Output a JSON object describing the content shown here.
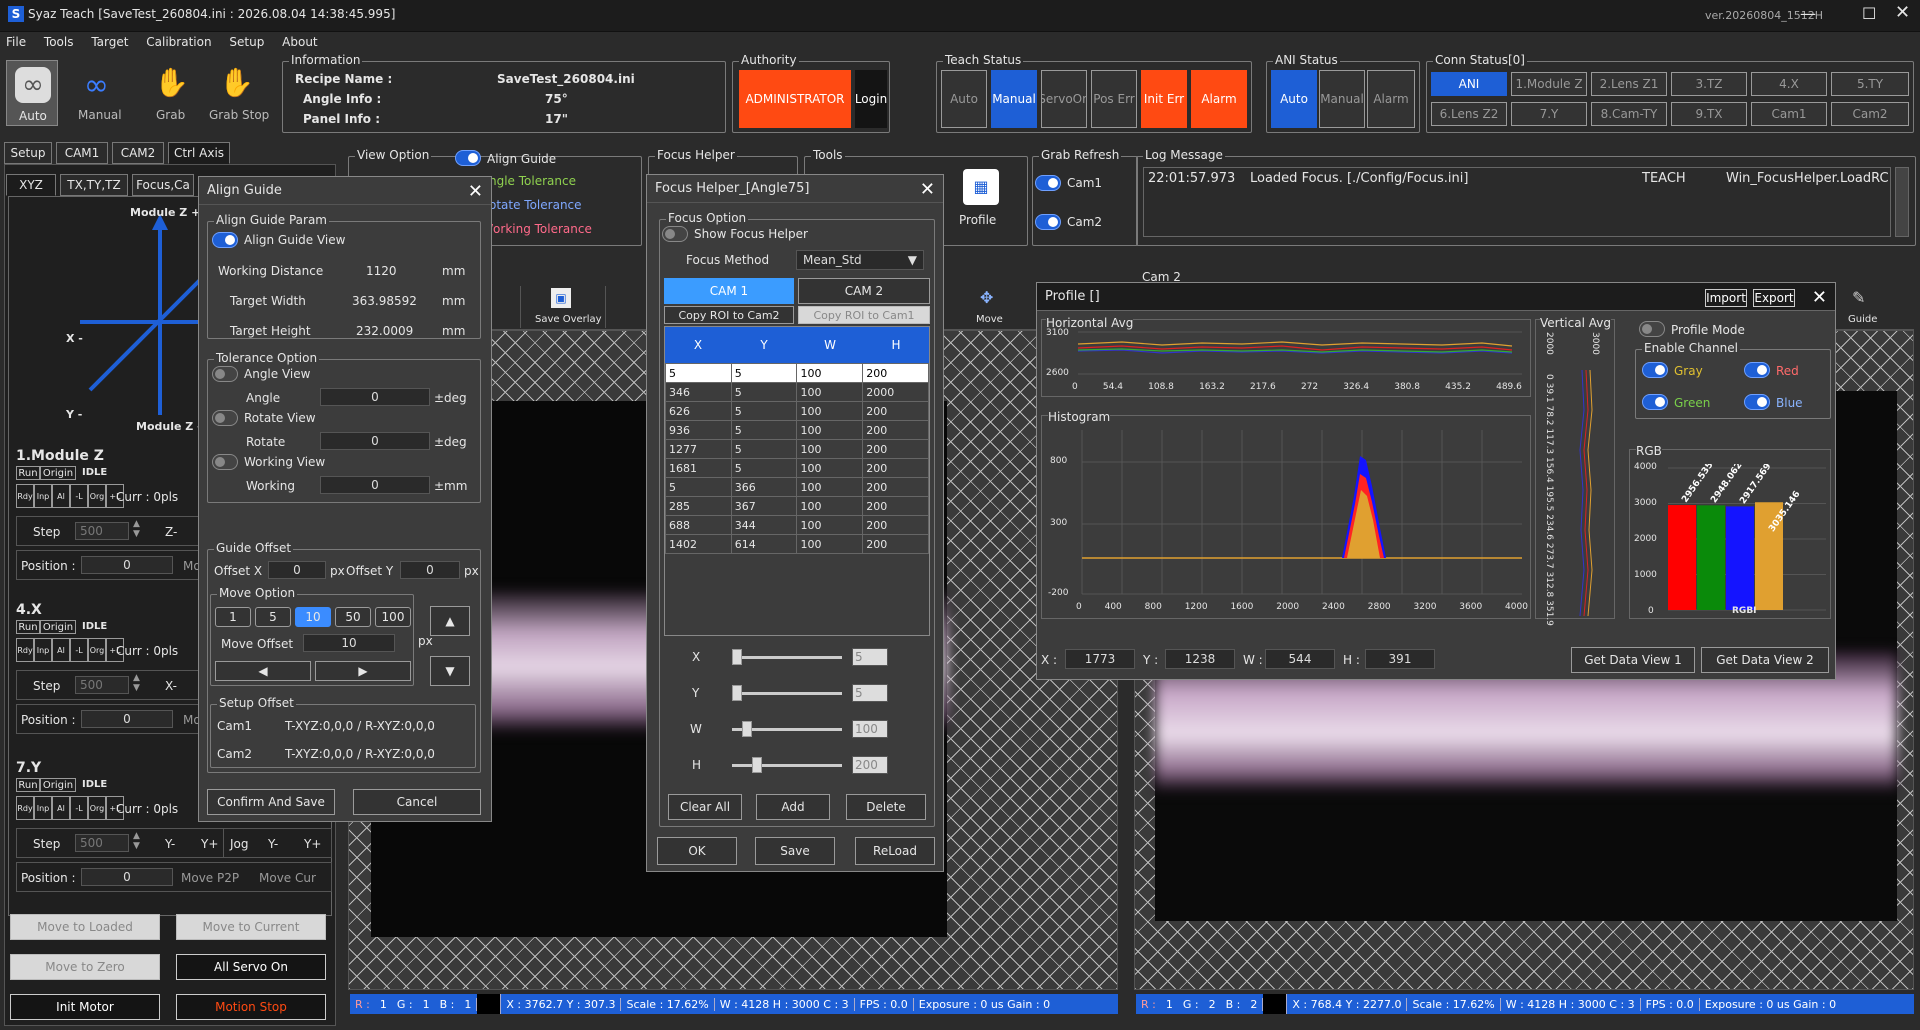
{
  "window": {
    "title": "Syaz Teach [SaveTest_260804.ini : 2026.08.04 14:38:45.995]",
    "version": "ver.20260804_1512H"
  },
  "menu": [
    "File",
    "Tools",
    "Target",
    "Calibration",
    "Setup",
    "About"
  ],
  "toolbar": {
    "auto": "Auto",
    "manual": "Manual",
    "grab": "Grab",
    "grab_stop": "Grab Stop"
  },
  "info": {
    "title": "Information",
    "recipe_label": "Recipe Name :",
    "recipe": "SaveTest_260804.ini",
    "angle_label": "Angle Info :",
    "angle": "75°",
    "panel_label": "Panel Info :",
    "panel": "17\""
  },
  "authority": {
    "title": "Authority",
    "role": "ADMINISTRATOR",
    "login": "Login"
  },
  "teach_status": {
    "title": "Teach Status",
    "items": [
      "Auto",
      "Manual",
      "ServoOn",
      "Pos Err",
      "Init Err",
      "Alarm"
    ]
  },
  "ani_status": {
    "title": "ANI Status",
    "items": [
      "Auto",
      "Manual",
      "Alarm"
    ]
  },
  "conn_status": {
    "title": "Conn Status[0]",
    "row1": [
      "ANI",
      "1.Module Z",
      "2.Lens Z1",
      "3.TZ",
      "4.X",
      "5.TY"
    ],
    "row2": [
      "6.Lens Z2",
      "7.Y",
      "8.Cam-TY",
      "9.TX",
      "Cam1",
      "Cam2"
    ]
  },
  "left_tabs": [
    "Setup",
    "CAM1",
    "CAM2",
    "Ctrl Axis"
  ],
  "sub_tabs": [
    "XYZ",
    "TX,TY,TZ",
    "Focus,Ca"
  ],
  "axis_diagram": {
    "top": "Module Z +",
    "x": "X -",
    "y": "Y -",
    "bottom": "Module Z -"
  },
  "axes": [
    {
      "name": "1.Module Z",
      "run": "Run",
      "origin": "Origin",
      "state": "IDLE",
      "flags": [
        "Rdy",
        "Inp",
        "Al",
        "-L",
        "Org",
        "+L"
      ],
      "curr": "Curr : 0pls",
      "step_label": "Step",
      "step": "500",
      "minus": "Z-",
      "pos_label": "Position :",
      "pos": "0",
      "move": "Mo"
    },
    {
      "name": "4.X",
      "run": "Run",
      "origin": "Origin",
      "state": "IDLE",
      "flags": [
        "Rdy",
        "Inp",
        "Al",
        "-L",
        "Org",
        "+L"
      ],
      "curr": "Curr : 0pls",
      "step_label": "Step",
      "step": "500",
      "minus": "X-",
      "pos_label": "Position :",
      "pos": "0",
      "move": "Mo"
    },
    {
      "name": "7.Y",
      "run": "Run",
      "origin": "Origin",
      "state": "IDLE",
      "flags": [
        "Rdy",
        "Inp",
        "Al",
        "-L",
        "Org",
        "+L"
      ],
      "curr": "Curr : 0pls",
      "step_label": "Step",
      "step": "500",
      "minus": "Y-",
      "plus": "Y+",
      "jog": "Jog",
      "jog_minus": "Y-",
      "jog_plus": "Y+",
      "pos_label": "Position :",
      "pos": "0",
      "move_p2p": "Move P2P",
      "move_cur": "Move Cur"
    }
  ],
  "bottom_buttons": {
    "move_loaded": "Move to Loaded",
    "move_current": "Move to Current",
    "move_zero": "Move to Zero",
    "all_servo": "All Servo On",
    "init_motor": "Init Motor",
    "motion_stop": "Motion Stop"
  },
  "view_option": {
    "title": "View Option",
    "align_guide": "Align Guide",
    "angle_tol": "ngle Tolerance",
    "rotate_tol": "otate Tolerance",
    "working_tol": "/orking Tolerance"
  },
  "align_dialog": {
    "title": "Align Guide",
    "param_title": "Align Guide Param",
    "view": "Align Guide View",
    "wd_label": "Working Distance",
    "wd": "1120",
    "tw_label": "Target Width",
    "tw": "363.98592",
    "th_label": "Target Height",
    "th": "232.0009",
    "unit_mm": "mm",
    "tol_title": "Tolerance Option",
    "angle_view": "Angle View",
    "angle": "Angle",
    "angle_val": "0",
    "deg": "±deg",
    "rotate_view": "Rotate View",
    "rotate": "Rotate",
    "rotate_val": "0",
    "working_view": "Working View",
    "working": "Working",
    "working_val": "0",
    "pmm": "±mm",
    "guide_title": "Guide Offset",
    "offx_label": "Offset X",
    "offx": "0",
    "px": "px",
    "offy_label": "Offset Y",
    "offy": "0",
    "move_title": "Move Option",
    "move_opts": [
      "1",
      "5",
      "10",
      "50",
      "100"
    ],
    "move_offset_label": "Move Offset",
    "move_offset": "10",
    "setup_title": "Setup Offset",
    "cam1_label": "Cam1",
    "cam1": "T-XYZ:0,0,0 / R-XYZ:0,0,0",
    "cam2_label": "Cam2",
    "cam2": "T-XYZ:0,0,0 / R-XYZ:0,0,0",
    "confirm": "Confirm And Save",
    "cancel": "Cancel"
  },
  "focus_group_title": "Focus Helper",
  "tools": {
    "title": "Tools",
    "profile": "Profile",
    "save_overlay": "Save Overlay",
    "move": "Move",
    "guide": "Guide"
  },
  "focus_dialog": {
    "title": "Focus Helper_[Angle75]",
    "option_title": "Focus Option",
    "show": "Show Focus Helper",
    "method_label": "Focus Method",
    "method": "Mean_Std",
    "cam1": "CAM 1",
    "cam2": "CAM 2",
    "copy_to_cam2": "Copy ROI to Cam2",
    "copy_to_cam1": "Copy ROI to Cam1",
    "headers": [
      "X",
      "Y",
      "W",
      "H"
    ],
    "rows": [
      [
        "5",
        "5",
        "100",
        "200"
      ],
      [
        "346",
        "5",
        "100",
        "2000"
      ],
      [
        "626",
        "5",
        "100",
        "200"
      ],
      [
        "936",
        "5",
        "100",
        "200"
      ],
      [
        "1277",
        "5",
        "100",
        "200"
      ],
      [
        "1681",
        "5",
        "100",
        "200"
      ],
      [
        "5",
        "366",
        "100",
        "200"
      ],
      [
        "285",
        "367",
        "100",
        "200"
      ],
      [
        "688",
        "344",
        "100",
        "200"
      ],
      [
        "1402",
        "614",
        "100",
        "200"
      ]
    ],
    "sx_label": "X",
    "sx": "5",
    "sy_label": "Y",
    "sy": "5",
    "sw_label": "W",
    "sw": "100",
    "sh_label": "H",
    "sh": "200",
    "clear": "Clear All",
    "add": "Add",
    "delete": "Delete",
    "ok": "OK",
    "save": "Save",
    "reload": "ReLoad"
  },
  "grab_refresh": {
    "title": "Grab Refresh",
    "cam1": "Cam1",
    "cam2": "Cam2"
  },
  "log": {
    "title": "Log Message",
    "time": "22:01:57.973",
    "msg": "Loaded Focus. [./Config/Focus.ini]",
    "mode": "TEACH",
    "src": "Win_FocusHelper.LoadRC"
  },
  "cam2_title": "Cam 2",
  "profile": {
    "title": "Profile []",
    "import": "Import",
    "export": "Export",
    "hz_title": "Horizontal Avg",
    "vt_title": "Vertical Avg",
    "hist_title": "Histogram",
    "hz_y": [
      "3100",
      "2600"
    ],
    "hz_x": [
      "0",
      "54.4",
      "108.8",
      "163.2",
      "217.6",
      "272",
      "326.4",
      "380.8",
      "435.2",
      "489.6"
    ],
    "vt_top": [
      "2000",
      "3000"
    ],
    "vt_y": "0  39.1  78.2  117.3  156.4  195.5  234.6  273.7  312.8  351.9",
    "hist_y": [
      "800",
      "300",
      "-200"
    ],
    "hist_x": [
      "0",
      "400",
      "800",
      "1200",
      "1600",
      "2000",
      "2400",
      "2800",
      "3200",
      "3600",
      "4000"
    ],
    "profile_mode": "Profile Mode",
    "enable_title": "Enable Channel",
    "gray": "Gray",
    "red": "Red",
    "green": "Green",
    "blue": "Blue",
    "rgb_title": "RGB",
    "rgb_y": [
      "4000",
      "3000",
      "2000",
      "1000",
      "0"
    ],
    "rgb_x": "RGBI",
    "x_label": "X :",
    "x": "1773",
    "y_label": "Y :",
    "y": "1238",
    "w_label": "W :",
    "w": "544",
    "h_label": "H :",
    "h": "391",
    "get1": "Get Data View 1",
    "get2": "Get Data View 2"
  },
  "chart_data": {
    "type": "bar",
    "title": "RGB",
    "categories": [
      "R",
      "G",
      "B",
      "I"
    ],
    "values": [
      2956.535,
      2948.062,
      2917.569,
      3035.146
    ],
    "ylim": [
      0,
      4000
    ]
  },
  "status1": {
    "r": "R :",
    "rv": "1",
    "g": "G :",
    "gv": "1",
    "b": "B :",
    "bv": "1",
    "xy": "X : 3762.7  Y : 307.3",
    "scale": "Scale : 17.62%",
    "size": "W : 4128  H : 3000  C : 3",
    "fps": "FPS : 0.0",
    "exp": "Exposure : 0 us  Gain : 0"
  },
  "status2": {
    "r": "R :",
    "rv": "1",
    "g": "G :",
    "gv": "2",
    "b": "B :",
    "bv": "2",
    "xy": "X : 768.4  Y : 2277.0",
    "scale": "Scale : 17.62%",
    "size": "W : 4128  H : 3000  C : 3",
    "fps": "FPS : 0.0",
    "exp": "Exposure : 0 us  Gain : 0"
  },
  "colors": {
    "accent": "#1e5fd6",
    "alarm": "#ff4a12",
    "bar_r": "#ff0000",
    "bar_g": "#0a8a0a",
    "bar_b": "#1414ff",
    "bar_i": "#e0a030"
  }
}
